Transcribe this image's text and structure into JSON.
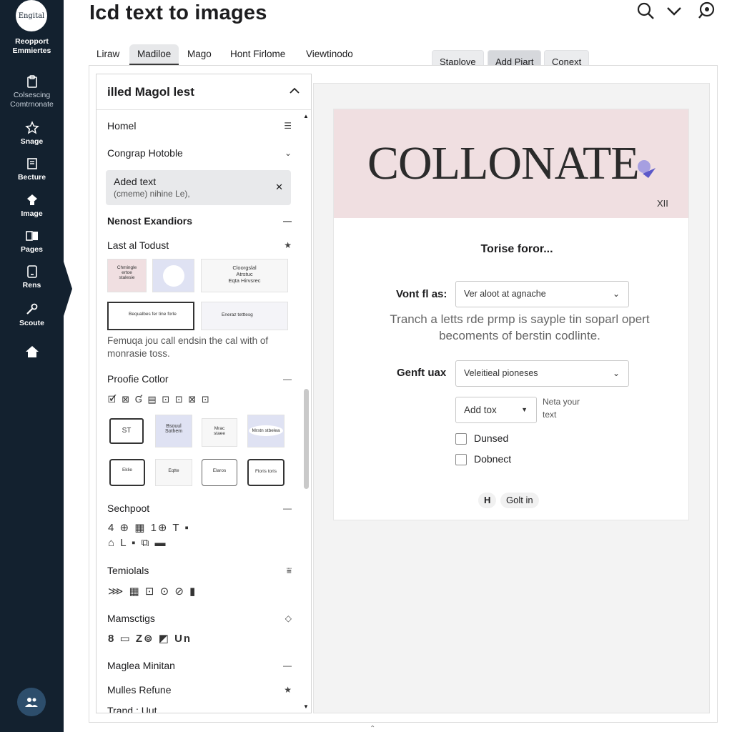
{
  "rail": {
    "logo": "Engital",
    "brand": "Reopport\nEmmiertes",
    "items": [
      {
        "label": "Colsescing\nComtrnonate",
        "icon": "clipboard-icon"
      },
      {
        "label": "Snage",
        "icon": "star-icon"
      },
      {
        "label": "Becture",
        "icon": "book-icon"
      },
      {
        "label": "Image",
        "icon": "image-icon"
      },
      {
        "label": "Pages",
        "icon": "pages-icon"
      },
      {
        "label": "Rens",
        "icon": "phone-icon"
      },
      {
        "label": "Scoute",
        "icon": "wrench-icon"
      },
      {
        "label": "",
        "icon": "home-icon"
      }
    ],
    "avatar_icon": "users-icon"
  },
  "header": {
    "title": "Icd text to images",
    "icons": [
      "search-icon",
      "chevron-down-icon",
      "zoom-icon"
    ]
  },
  "tabs": [
    "Liraw",
    "Madiloe",
    "Mago",
    "Hont Firlome",
    "Viewtinodo"
  ],
  "active_tab": "Madiloe",
  "toolbar": {
    "b1": "Staplove",
    "b2": "Add Piart",
    "b3": "Conext"
  },
  "panel": {
    "title": "illed Magol lest",
    "rows": {
      "homel": "Homel",
      "congrap": "Congrap Hotoble",
      "chip_title": "Aded text",
      "chip_sub": "(cmeme) nihine Le),",
      "nenost": "Nenost Exandiors",
      "last": "Last al Todust",
      "desc": "Femuqa jou call endsin the cal with of monrasie toss.",
      "proofie": "Proofie Cotlor",
      "sechpoot": "Sechpoot",
      "temiolals": "Temiolals",
      "mamsctigs": "Mamsctigs",
      "maglea": "Maglea Minitan",
      "mulles": "Mulles Refune",
      "trand": "Trand : Uut"
    },
    "thumbs": {
      "t1": "Chmingle\nertoe\nstalesie",
      "t3": "Cloorgslal\nAtrstuc\nEqta Hirvsrec",
      "t4": "Bequalbes fer tine forle",
      "t5": "Eneraz tetttesg",
      "s1": "ST",
      "s2": "Bsouul\nSothem",
      "s3": "Mrac\nstaee",
      "s4": "Mrstn stbelea",
      "s5": "Eklie",
      "s6": "Eqtte",
      "s7": "Elaros",
      "s8": "Floris toris"
    },
    "icon_strips": {
      "a": "🗹 ⊠ Ɠ ▤ ⊡ ⊡ ⊠ ⊡",
      "b": "4 ⊕ ▦ 1⊕ T ▪",
      "c": "⌂ L ▪ ⧉ ▬",
      "d": "⋙ ▦ ⊡ ⊙ ⊘ ▮",
      "e": "8 ▭ Z⊚ ◩ Un"
    }
  },
  "preview": {
    "banner_text": "COLLONATE",
    "banner_sub": "XII",
    "heading": "Torise foror...",
    "field1_label": "Vont fl as:",
    "field1_value": "Ver aloot at agnache",
    "paragraph": "Tranch a letts rde prmp is sayple tin soparl opert becoments of berstin codlinte.",
    "field2_label": "Genft uax",
    "field2_value": "Veleitieal pioneses",
    "field3_value": "Add tox",
    "note": "Neta your\ntext",
    "cb1": "Dunsed",
    "cb2": "Dobnect",
    "pill1": "H",
    "pill2": "Golt in"
  },
  "colors": {
    "rail": "#13212f",
    "banner": "#f0dfe1",
    "accent": "#5b58c9"
  }
}
